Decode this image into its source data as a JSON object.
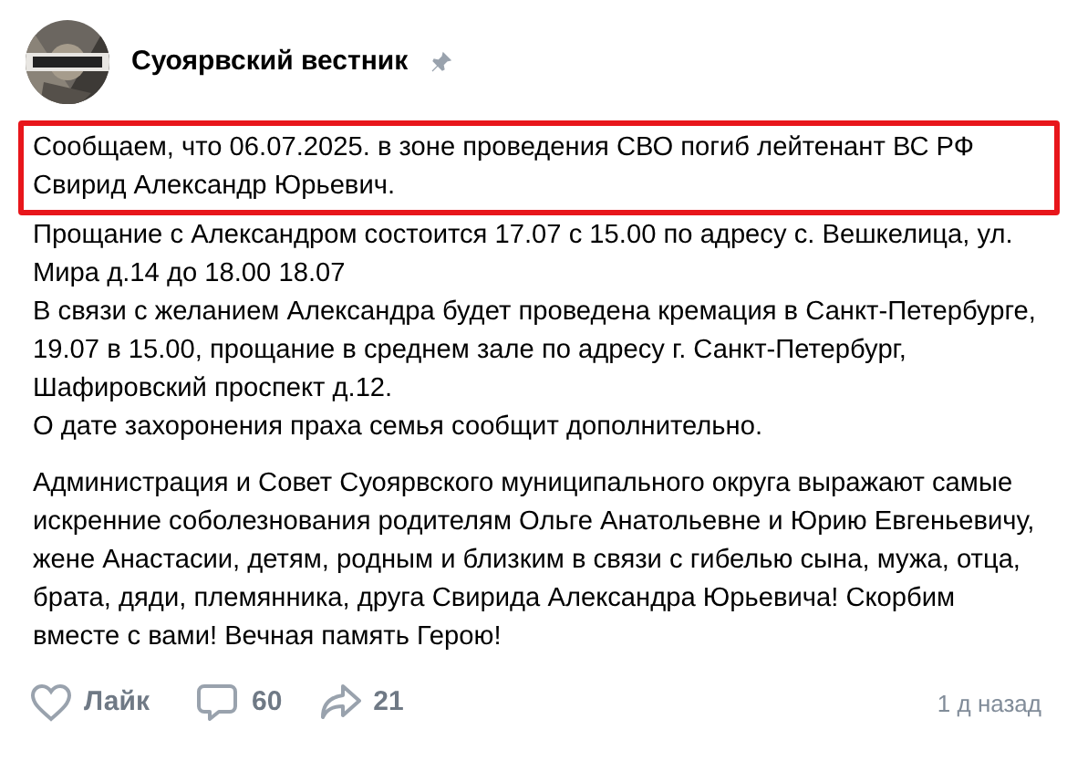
{
  "post": {
    "author": "Суоярвский вестник",
    "pinned": true,
    "paragraphs": [
      {
        "text": "Сообщаем, что 06.07.2025. в зоне проведения СВО погиб лейтенант ВС РФ Свирид Александр Юрьевич.",
        "highlighted": true
      },
      {
        "text": "Прощание с Александром состоится 17.07 с 15.00 по адресу с. Вешкелица, ул. Мира д.14 до 18.00 18.07",
        "highlighted": false
      },
      {
        "text": "В связи с желанием Александра будет проведена кремация в Санкт-Петербурге, 19.07 в 15.00, прощание в среднем зале по адресу г. Санкт-Петербург, Шафировский проспект д.12.",
        "highlighted": false
      },
      {
        "text": "О дате захоронения праха семья сообщит дополнительно.",
        "highlighted": false
      }
    ],
    "condolence": "Администрация и Совет Суоярвского муниципального округа выражают самые искренние соболезнования родителям Ольге Анатольевне и Юрию Евгеньевичу, жене Анастасии, детям, родным и близким в связи с гибелью сына, мужа, отца, брата, дяди, племянника, друга Свирида Александра Юрьевича! Скорбим вместе с вами! Вечная память Герою!",
    "like": {
      "label": "Лайк",
      "selected": false
    },
    "comments": "60",
    "shares": "21",
    "time": "1 д назад"
  }
}
